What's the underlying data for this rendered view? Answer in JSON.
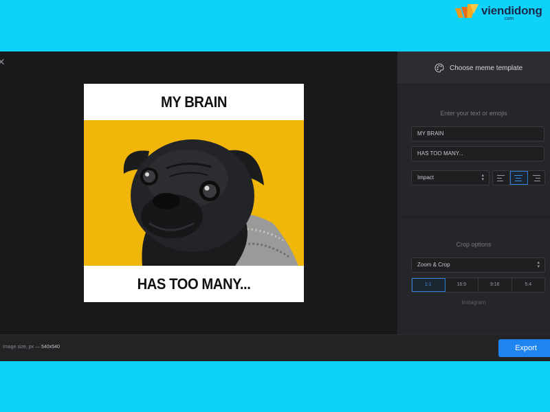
{
  "watermark": {
    "brand": "viendidong",
    "sub": ".com"
  },
  "header": {
    "choose_template_label": "Choose meme template"
  },
  "text_section": {
    "label": "Enter your text or emojis",
    "top_text_value": "MY BRAIN",
    "bottom_text_value": "HAS TOO MANY...",
    "font": "Impact",
    "alignment": "center"
  },
  "meme": {
    "top_text": "MY BRAIN",
    "bottom_text": "HAS TOO MANY...",
    "background_color": "#f0b60a"
  },
  "crop_section": {
    "label": "Crop options",
    "mode": "Zoom & Crop",
    "ratios": [
      "1:1",
      "16:9",
      "9:16",
      "5:4"
    ],
    "selected_ratio": "1:1",
    "preset_caption": "Instagram"
  },
  "footer": {
    "size_label": "Image size, px —",
    "size_value": "540x540",
    "export_label": "Export"
  },
  "colors": {
    "accent": "#1d84f0",
    "background": "#0fd2fb"
  }
}
